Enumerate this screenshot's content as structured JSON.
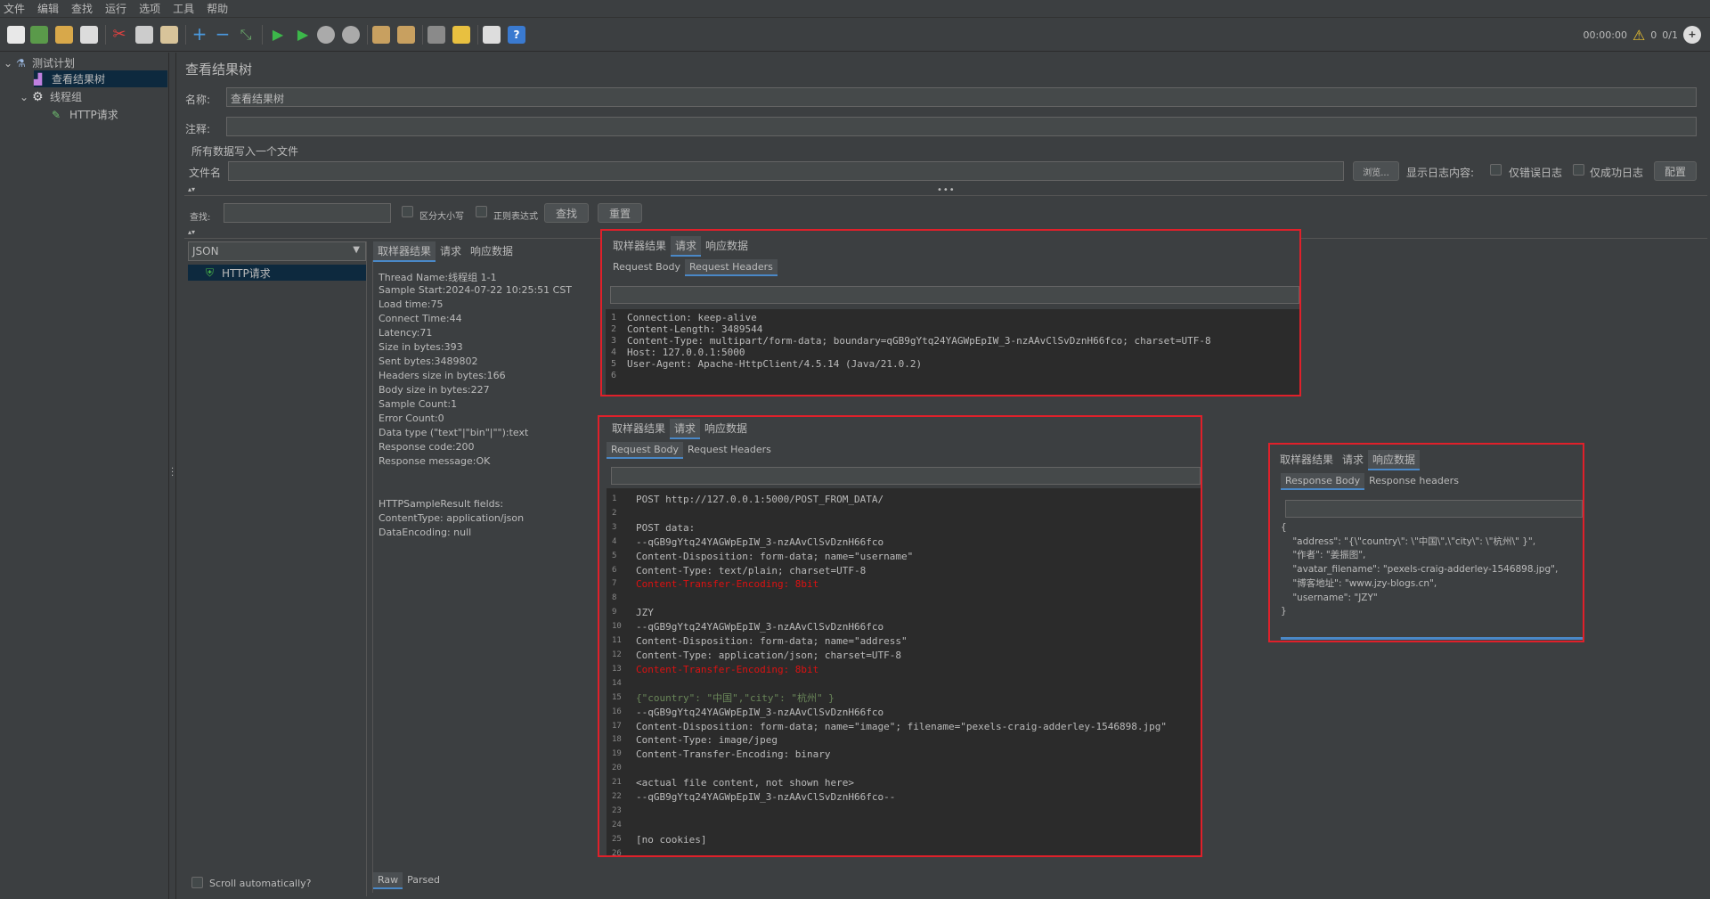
{
  "menu": [
    "文件",
    "编辑",
    "查找",
    "运行",
    "选项",
    "工具",
    "帮助"
  ],
  "status": {
    "time": "00:00:00",
    "warnings": "0",
    "threads": "0/1"
  },
  "tree": {
    "plan": "测试计划",
    "listener": "查看结果树",
    "thread_group": "线程组",
    "sampler": "HTTP请求"
  },
  "page_title": "查看结果树",
  "form": {
    "name_label": "名称:",
    "name_value": "查看结果树",
    "comment_label": "注释:",
    "comment_value": "",
    "write_all": "所有数据写入一个文件",
    "file_label": "文件名",
    "file_value": "",
    "browse": "浏览...",
    "log_label": "显示日志内容:",
    "errors_only": "仅错误日志",
    "success_only": "仅成功日志",
    "config": "配置"
  },
  "search": {
    "label": "查找:",
    "case": "区分大小写",
    "regex": "正则表达式",
    "find": "查找",
    "reset": "重置"
  },
  "renderer": "JSON",
  "result_item": "HTTP请求",
  "scroll_auto": "Scroll automatically?",
  "bottom_tabs": {
    "raw": "Raw",
    "parsed": "Parsed"
  },
  "result_tabs": {
    "sampler": "取样器结果",
    "request": "请求",
    "response": "响应数据"
  },
  "sampler_info": [
    "Thread Name:线程组 1-1",
    "Sample Start:2024-07-22 10:25:51 CST",
    "Load time:75",
    "Connect Time:44",
    "Latency:71",
    "Size in bytes:393",
    "Sent bytes:3489802",
    "Headers size in bytes:166",
    "Body size in bytes:227",
    "Sample Count:1",
    "Error Count:0",
    "Data type (\"text\"|\"bin\"|\"\"):text",
    "Response code:200",
    "Response message:OK",
    "",
    "",
    "HTTPSampleResult fields:",
    "ContentType: application/json",
    "DataEncoding: null"
  ],
  "headers_panel": {
    "subtab_body": "Request Body",
    "subtab_headers": "Request Headers",
    "lines": [
      "Connection: keep-alive",
      "Content-Length: 3489544",
      "Content-Type: multipart/form-data; boundary=qGB9gYtq24YAGWpEpIW_3-nzAAvClSvDznH66fco; charset=UTF-8",
      "Host: 127.0.0.1:5000",
      "User-Agent: Apache-HttpClient/4.5.14 (Java/21.0.2)",
      ""
    ]
  },
  "body_panel": {
    "lines": [
      "POST http://127.0.0.1:5000/POST_FROM_DATA/",
      "",
      "POST data:",
      "--qGB9gYtq24YAGWpEpIW_3-nzAAvClSvDznH66fco",
      "Content-Disposition: form-data; name=\"username\"",
      "Content-Type: text/plain; charset=UTF-8",
      "Content-Transfer-Encoding: 8bit",
      "",
      "JZY",
      "--qGB9gYtq24YAGWpEpIW_3-nzAAvClSvDznH66fco",
      "Content-Disposition: form-data; name=\"address\"",
      "Content-Type: application/json; charset=UTF-8",
      "Content-Transfer-Encoding: 8bit",
      "",
      "{\"country\": \"中国\",\"city\": \"杭州\" }",
      "--qGB9gYtq24YAGWpEpIW_3-nzAAvClSvDznH66fco",
      "Content-Disposition: form-data; name=\"image\"; filename=\"pexels-craig-adderley-1546898.jpg\"",
      "Content-Type: image/jpeg",
      "Content-Transfer-Encoding: binary",
      "",
      "<actual file content, not shown here>",
      "--qGB9gYtq24YAGWpEpIW_3-nzAAvClSvDznH66fco--",
      "",
      "",
      "[no cookies]",
      ""
    ]
  },
  "response_panel": {
    "subtab_body": "Response Body",
    "subtab_headers": "Response headers",
    "lines": [
      "{",
      "    \"address\": \"{\\\"country\\\": \\\"中国\\\",\\\"city\\\": \\\"杭州\\\" }\",",
      "    \"作者\": \"姜振图\",",
      "    \"avatar_filename\": \"pexels-craig-adderley-1546898.jpg\",",
      "    \"博客地址\": \"www.jzy-blogs.cn\",",
      "    \"username\": \"JZY\"",
      "}"
    ]
  },
  "colors": {
    "bg": "#3c3f41",
    "editor": "#2b2b2b",
    "highlight": "#e0202a",
    "accent": "#4a88c7"
  }
}
